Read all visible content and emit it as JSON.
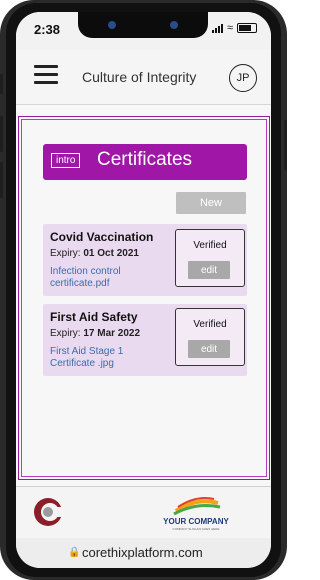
{
  "status": {
    "time": "2:38"
  },
  "appbar": {
    "title": "Culture of Integrity",
    "avatar_initials": "JP"
  },
  "section": {
    "badge": "intro",
    "title": "Certificates",
    "new_label": "New"
  },
  "certificates": [
    {
      "title": "Covid Vaccination",
      "expiry_label": "Expiry:",
      "expiry_date": "01 Oct 2021",
      "file": "Infection control certificate.pdf",
      "status": "Verified",
      "edit_label": "edit"
    },
    {
      "title": "First Aid Safety",
      "expiry_label": "Expiry:",
      "expiry_date": "17 Mar 2022",
      "file": "First Aid Stage 1 Certificate .jpg",
      "status": "Verified",
      "edit_label": "edit"
    }
  ],
  "footer": {
    "company_name": "YOUR COMPANY",
    "company_slogan": "COMPANY SLOGAN GOES HERE"
  },
  "browser": {
    "url": "corethixplatform.com"
  },
  "colors": {
    "accent": "#a017a8",
    "card_bg": "#eadaf0",
    "link": "#3a6ea8"
  }
}
